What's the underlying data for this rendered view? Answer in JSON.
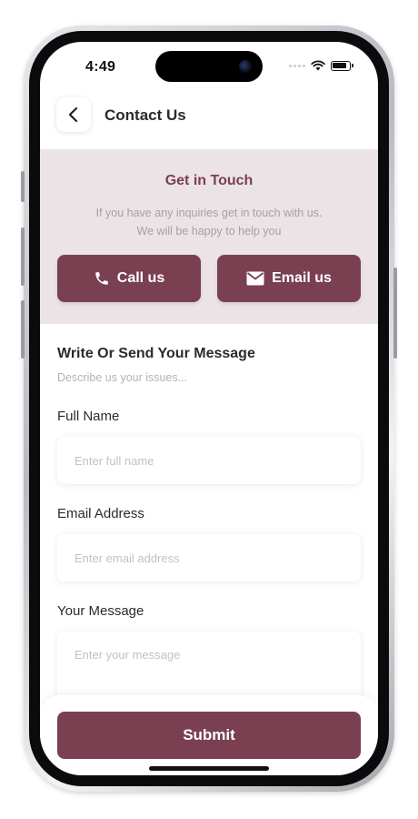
{
  "status": {
    "time": "4:49",
    "icons": [
      "cellular-dots-icon",
      "wifi-icon",
      "battery-icon"
    ]
  },
  "header": {
    "title": "Contact Us",
    "back_icon": "chevron-left-icon"
  },
  "touch": {
    "title": "Get in Touch",
    "subtitle_line1": "If you have any inquiries get in touch with us.",
    "subtitle_line2": "We will be happy to help you",
    "call_label": "Call us",
    "call_icon": "phone-icon",
    "email_label": "Email us",
    "email_icon": "mail-icon"
  },
  "form": {
    "heading": "Write Or Send Your Message",
    "description": "Describe us your issues...",
    "full_name": {
      "label": "Full Name",
      "placeholder": "Enter full name",
      "value": ""
    },
    "email": {
      "label": "Email Address",
      "placeholder": "Enter email address",
      "value": ""
    },
    "message": {
      "label": "Your Message",
      "placeholder": "Enter your message",
      "value": ""
    },
    "submit_label": "Submit"
  },
  "colors": {
    "accent": "#7a4052",
    "panel_bg": "#ebe3e5",
    "text_dark": "#2b2b2b",
    "placeholder": "#c2c2c2"
  }
}
